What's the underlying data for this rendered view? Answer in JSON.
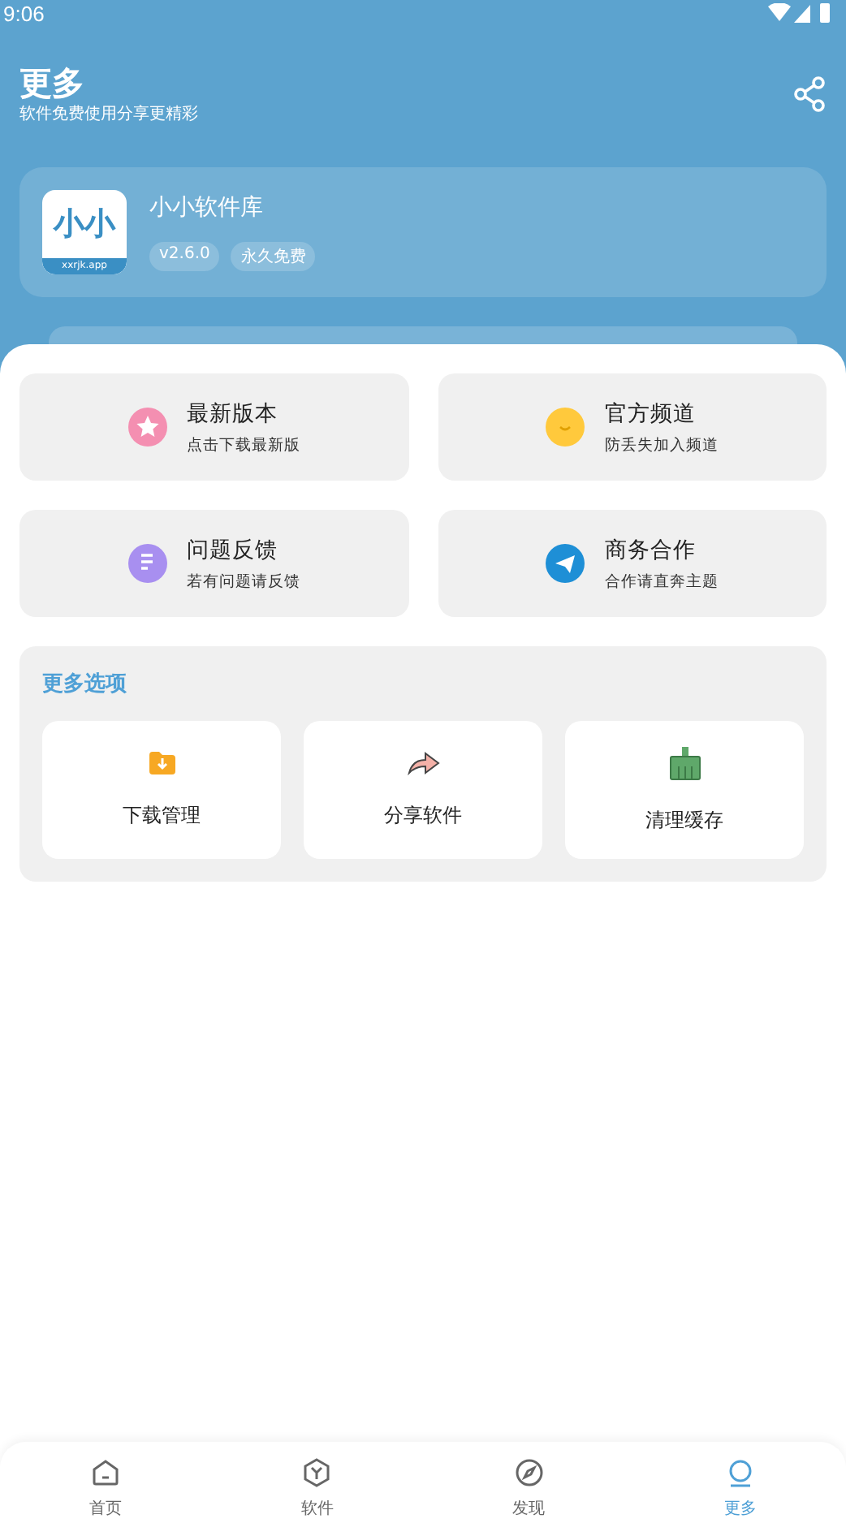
{
  "status_bar": {
    "time": "9:06"
  },
  "header": {
    "title": "更多",
    "subtitle": "软件免费使用分享更精彩"
  },
  "app_card": {
    "logo_text": "小小",
    "logo_caption": "xxrjk.app",
    "name": "小小软件库",
    "tags": [
      "v2.6.0",
      "永久免费"
    ]
  },
  "links": [
    {
      "kind": "star",
      "title": "最新版本",
      "subtitle": "点击下载最新版"
    },
    {
      "kind": "chat",
      "title": "官方频道",
      "subtitle": "防丢失加入频道"
    },
    {
      "kind": "note",
      "title": "问题反馈",
      "subtitle": "若有问题请反馈"
    },
    {
      "kind": "plane",
      "title": "商务合作",
      "subtitle": "合作请直奔主题"
    }
  ],
  "more_options": {
    "title": "更多选项",
    "items": [
      {
        "kind": "folder",
        "label": "下载管理"
      },
      {
        "kind": "share",
        "label": "分享软件"
      },
      {
        "kind": "broom",
        "label": "清理缓存"
      }
    ]
  },
  "nav": [
    {
      "kind": "home",
      "label": "首页",
      "selected": false
    },
    {
      "kind": "cube",
      "label": "软件",
      "selected": false
    },
    {
      "kind": "compass",
      "label": "发现",
      "selected": false
    },
    {
      "kind": "user",
      "label": "更多",
      "selected": true
    }
  ]
}
